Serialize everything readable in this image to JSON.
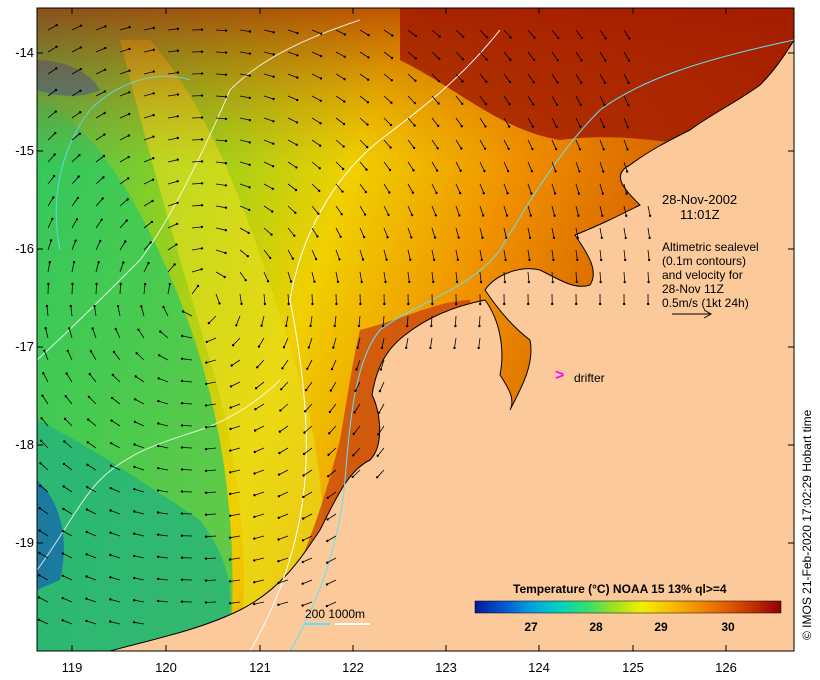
{
  "map": {
    "date_line1": "28-Nov-2002",
    "date_line2": "11:01Z",
    "legend_lines": [
      "Altimetric sealevel",
      "(0.1m contours)",
      "and velocity for",
      "28-Nov 11Z",
      "0.5m/s (1kt 24h)"
    ],
    "drifter_symbol": ">",
    "drifter_label": "drifter",
    "depth_label": "200  1000m",
    "credit": "© IMOS 21-Feb-2020 17:02:29 Hobart time",
    "colorbar": {
      "title": "Temperature (°C) NOAA 15 13% ql>=4",
      "ticks": [
        "27",
        "28",
        "29",
        "30"
      ],
      "colors": [
        "#001a9a",
        "#0055d0",
        "#00a0e0",
        "#00d0c0",
        "#30e070",
        "#a0e020",
        "#f0f000",
        "#f8c000",
        "#f09000",
        "#e06000",
        "#c03000",
        "#900000"
      ]
    },
    "y_axis": {
      "labels": [
        "-14",
        "-15",
        "-16",
        "-17",
        "-18",
        "-19"
      ]
    },
    "x_axis": {
      "labels": [
        "119",
        "120",
        "121",
        "122",
        "123",
        "124",
        "125",
        "126"
      ]
    },
    "colors": {
      "land": "#fbc99a",
      "frame": "#000000",
      "drifter": "#ff00ff",
      "depth_200": "#60e0ff",
      "depth_1000": "#ffffff"
    }
  }
}
